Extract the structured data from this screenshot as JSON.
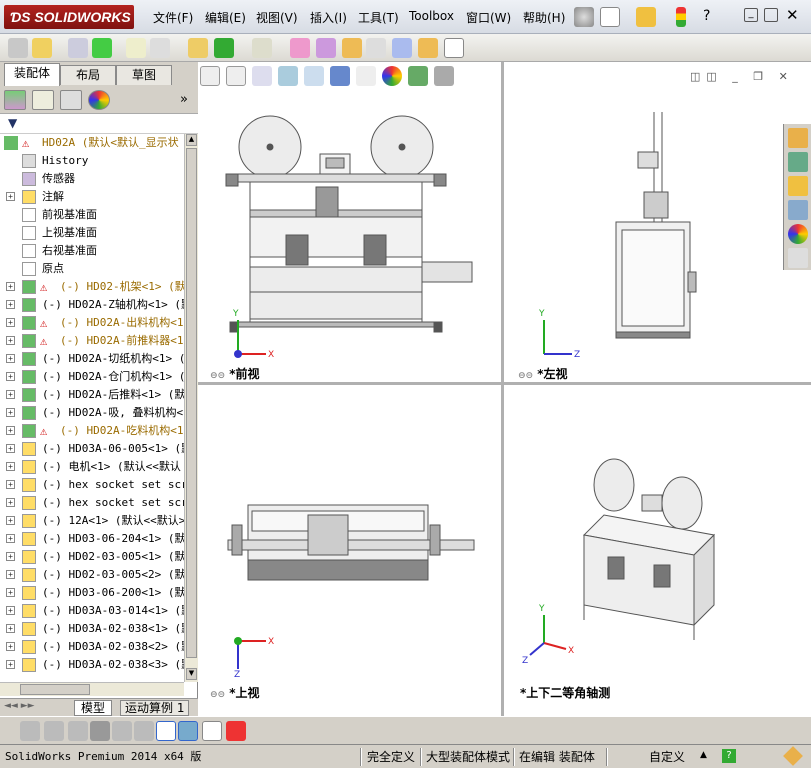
{
  "app": {
    "logo_text": "SOLIDWORKS"
  },
  "menu": [
    "文件(F)",
    "编辑(E)",
    "视图(V)",
    "插入(I)",
    "工具(T)",
    "Toolbox",
    "窗口(W)",
    "帮助(H)"
  ],
  "tabs": {
    "assembly": "装配体",
    "layout": "布局",
    "sketch": "草图"
  },
  "tree": {
    "root": "HD02A  (默认<默认_显示状",
    "items": [
      {
        "label": "History",
        "type": "history",
        "expand": false,
        "warn": false
      },
      {
        "label": "传感器",
        "type": "sensor",
        "expand": false,
        "warn": false
      },
      {
        "label": "注解",
        "type": "annot",
        "expand": true,
        "warn": false
      },
      {
        "label": "前视基准面",
        "type": "plane",
        "expand": false,
        "warn": false
      },
      {
        "label": "上视基准面",
        "type": "plane",
        "expand": false,
        "warn": false
      },
      {
        "label": "右视基准面",
        "type": "plane",
        "expand": false,
        "warn": false
      },
      {
        "label": "原点",
        "type": "origin",
        "expand": false,
        "warn": false
      },
      {
        "label": "(-) HD02-机架<1> (默",
        "type": "asm",
        "expand": true,
        "warn": true
      },
      {
        "label": "(-) HD02A-Z轴机构<1> (默",
        "type": "asm",
        "expand": true,
        "warn": false
      },
      {
        "label": "(-) HD02A-出料机构<1",
        "type": "asm",
        "expand": true,
        "warn": true
      },
      {
        "label": "(-) HD02A-前推料器<1",
        "type": "asm",
        "expand": true,
        "warn": true
      },
      {
        "label": "(-) HD02A-切纸机构<1> (",
        "type": "asm",
        "expand": true,
        "warn": false
      },
      {
        "label": "(-) HD02A-仓门机构<1> (",
        "type": "asm",
        "expand": true,
        "warn": false
      },
      {
        "label": "(-) HD02A-后推料<1> (默",
        "type": "asm",
        "expand": true,
        "warn": false
      },
      {
        "label": "(-) HD02A-吸, 叠料机构<",
        "type": "asm",
        "expand": true,
        "warn": false
      },
      {
        "label": "(-) HD02A-吃料机构<1",
        "type": "asm",
        "expand": true,
        "warn": true
      },
      {
        "label": "(-) HD03A-06-005<1> (默",
        "type": "part",
        "expand": true,
        "warn": false
      },
      {
        "label": "(-) 电机<1> (默认<<默认",
        "type": "part",
        "expand": true,
        "warn": false
      },
      {
        "label": "(-) hex socket set scre",
        "type": "part",
        "expand": true,
        "warn": false
      },
      {
        "label": "(-) hex socket set scre",
        "type": "part",
        "expand": true,
        "warn": false
      },
      {
        "label": "(-) 12A<1> (默认<<默认>",
        "type": "part",
        "expand": true,
        "warn": false
      },
      {
        "label": "(-) HD03-06-204<1> (默认",
        "type": "part",
        "expand": true,
        "warn": false
      },
      {
        "label": "(-) HD02-03-005<1> (默认",
        "type": "part",
        "expand": true,
        "warn": false
      },
      {
        "label": "(-) HD02-03-005<2> (默认",
        "type": "part",
        "expand": true,
        "warn": false
      },
      {
        "label": "(-) HD03-06-200<1> (默认",
        "type": "part",
        "expand": true,
        "warn": false
      },
      {
        "label": "(-) HD03A-03-014<1> (默",
        "type": "part",
        "expand": true,
        "warn": false
      },
      {
        "label": "(-) HD03A-02-038<1> (默",
        "type": "part",
        "expand": true,
        "warn": false
      },
      {
        "label": "(-) HD03A-02-038<2> (默",
        "type": "part",
        "expand": true,
        "warn": false
      },
      {
        "label": "(-) HD03A-02-038<3> (默",
        "type": "part",
        "expand": true,
        "warn": false
      }
    ]
  },
  "lower_tabs": {
    "model": "模型",
    "motion": "运动算例 1"
  },
  "viewports": {
    "front": "*前视",
    "left": "*左视",
    "top": "*上视",
    "iso": "*上下二等角轴测"
  },
  "axes": {
    "x": "X",
    "y": "Y",
    "z": "Z"
  },
  "status": {
    "product": "SolidWorks Premium 2014 x64 版",
    "defined": "完全定义",
    "large_asm": "大型装配体模式",
    "editing": "在编辑 装配体",
    "custom": "自定义"
  },
  "colors": {
    "warn": "#f5c400",
    "title_red": "#b3231f",
    "frame": "#8c8c8c"
  }
}
